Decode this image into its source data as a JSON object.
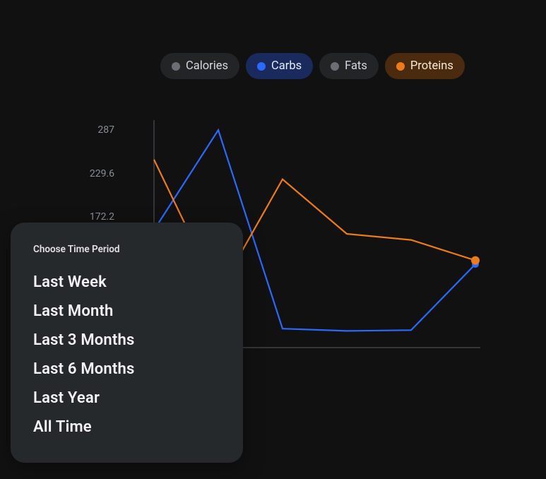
{
  "legend": [
    {
      "key": "calories",
      "label": "Calories",
      "state": "inactive"
    },
    {
      "key": "carbs",
      "label": "Carbs",
      "state": "carbs"
    },
    {
      "key": "fats",
      "label": "Fats",
      "state": "inactive"
    },
    {
      "key": "proteins",
      "label": "Proteins",
      "state": "proteins"
    }
  ],
  "popover": {
    "title": "Choose Time Period",
    "options": [
      "Last Week",
      "Last Month",
      "Last 3 Months",
      "Last 6 Months",
      "Last Year",
      "All Time"
    ]
  },
  "y_ticks": [
    "287",
    "229.6",
    "172.2"
  ],
  "chart_data": {
    "type": "line",
    "xlabel": "",
    "ylabel": "",
    "ylim": [
      0,
      287
    ],
    "y_ticks_shown": [
      287,
      229.6,
      172.2
    ],
    "x": [
      0,
      1,
      2,
      3,
      4,
      5
    ],
    "series": [
      {
        "name": "Carbs",
        "color": "#2b69ff",
        "values": [
          155,
          287,
          25,
          22,
          23,
          110
        ]
      },
      {
        "name": "Proteins",
        "color": "#ec7b1a",
        "values": [
          248,
          72,
          222,
          150,
          142,
          115
        ]
      }
    ]
  }
}
